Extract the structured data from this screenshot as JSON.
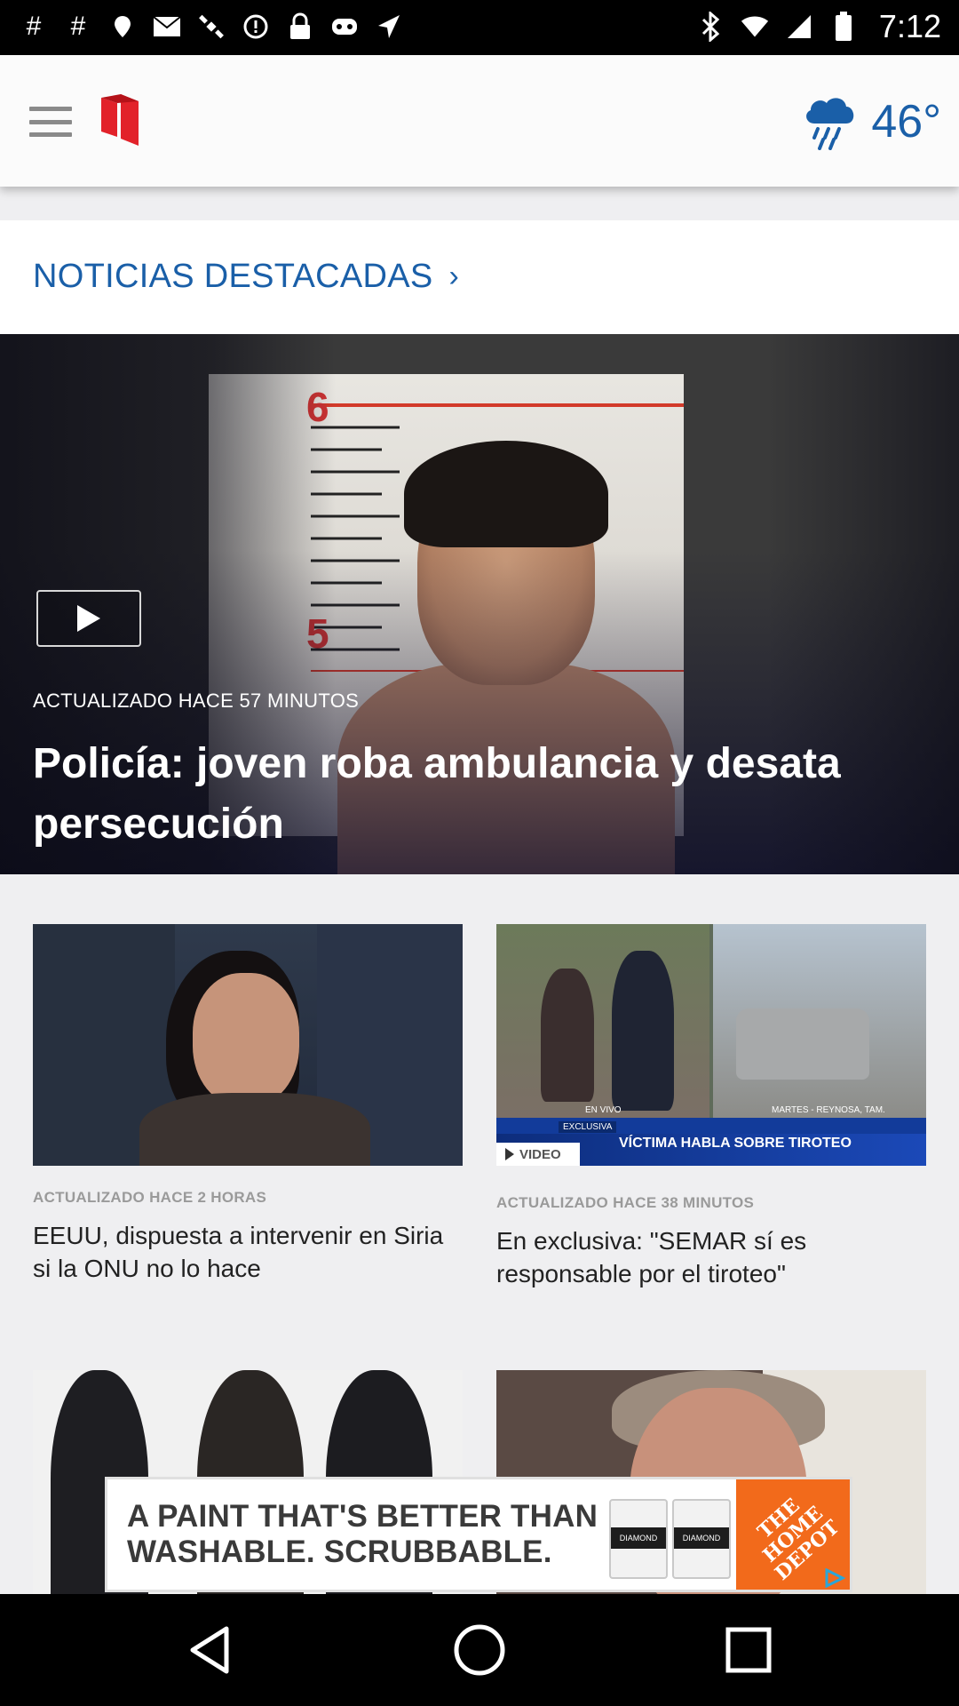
{
  "status_bar": {
    "time": "7:12",
    "left_icons": [
      "hashtag-icon",
      "hashtag-icon",
      "fake-gps-icon",
      "mail-icon",
      "satellite-icon",
      "alert-icon",
      "lock-icon",
      "game-controller-icon",
      "location-icon"
    ],
    "right_icons": [
      "bluetooth-icon",
      "wifi-icon",
      "cellular-signal-icon",
      "battery-icon"
    ]
  },
  "header": {
    "menu_icon": "menu-icon",
    "logo_icon": "telemundo-logo-icon",
    "weather_icon": "rain-cloud-icon",
    "temperature": "46°"
  },
  "section": {
    "title": "NOTICIAS DESTACADAS",
    "chevron": "›"
  },
  "hero": {
    "updated": "ACTUALIZADO HACE 57 MINUTOS",
    "title": "Policía: joven roba ambulancia y desata persecución",
    "scale_marks": [
      "6",
      "5"
    ]
  },
  "cards": [
    {
      "updated": "ACTUALIZADO HACE 2 HORAS",
      "title": "EEUU, dispuesta a intervenir en Siria si la ONU no lo hace"
    },
    {
      "updated": "ACTUALIZADO HACE 38 MINUTOS",
      "title": "En exclusiva: \"SEMAR sí es responsable por el tiroteo\"",
      "badge": "VIDEO",
      "tv_banner": "VÍCTIMA HABLA SOBRE TIROTEO",
      "tv_tag": "EXCLUSIVA",
      "tv_live": "EN VIVO",
      "tv_location": "MARTES - REYNOSA, TAM."
    }
  ],
  "ad": {
    "text": "A PAINT THAT'S BETTER THAN WASHABLE. SCRUBBABLE.",
    "can_label": "DIAMOND",
    "brand": "THE HOME DEPOT"
  },
  "nav": {
    "back": "back-icon",
    "home": "home-icon",
    "recents": "recents-icon"
  },
  "colors": {
    "accent": "#1a5fa8",
    "brand_red": "#e2222a",
    "ad_orange": "#f26a1b"
  }
}
